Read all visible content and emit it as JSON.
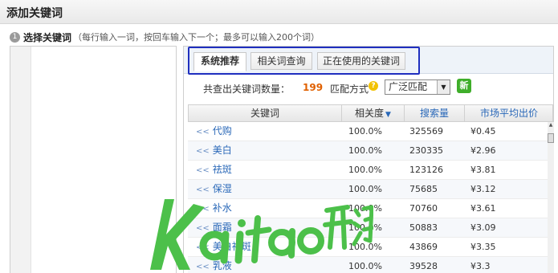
{
  "dialog": {
    "title": "添加关键词"
  },
  "step": {
    "number": "1",
    "label": "选择关键词",
    "hint": "（每行输入一词，按回车输入下一个；最多可以输入200个词）"
  },
  "tabs": [
    {
      "label": "系统推荐",
      "active": true
    },
    {
      "label": "相关词查询",
      "active": false
    },
    {
      "label": "正在使用的关键词",
      "active": false
    }
  ],
  "summary": {
    "count_label": "共查出关键词数量：",
    "count": "199",
    "match_label": "匹配方式",
    "match_value": "广泛匹配",
    "new_badge": "新"
  },
  "table": {
    "headers": {
      "keyword": "关键词",
      "relevance": "相关度",
      "searches": "搜索量",
      "avg_price": "市场平均出价"
    },
    "rows": [
      {
        "keyword": "代购",
        "relevance": "100.0%",
        "searches": "325569",
        "price": "¥0.45"
      },
      {
        "keyword": "美白",
        "relevance": "100.0%",
        "searches": "230335",
        "price": "¥2.96"
      },
      {
        "keyword": "祛斑",
        "relevance": "100.0%",
        "searches": "123126",
        "price": "¥3.81"
      },
      {
        "keyword": "保湿",
        "relevance": "100.0%",
        "searches": "75685",
        "price": "¥3.12"
      },
      {
        "keyword": "补水",
        "relevance": "100.0%",
        "searches": "70760",
        "price": "¥3.61"
      },
      {
        "keyword": "面霜",
        "relevance": "100.0%",
        "searches": "50883",
        "price": "¥3.09"
      },
      {
        "keyword": "美白祛斑",
        "relevance": "100.0%",
        "searches": "43869",
        "price": "¥3.35"
      },
      {
        "keyword": "乳液",
        "relevance": "100.0%",
        "searches": "39528",
        "price": "¥3.3"
      }
    ]
  },
  "icons": {
    "chevron": "<<",
    "sort": "▼",
    "select_arrow": "▼",
    "scroll_up": "▲",
    "help": "?"
  },
  "watermark": {
    "text": "Kaitao开淘",
    "color": "#4cc04a"
  }
}
